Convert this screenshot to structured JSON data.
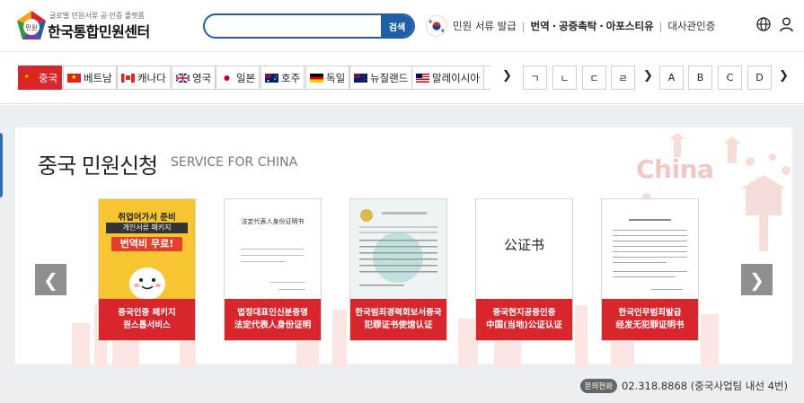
{
  "header": {
    "tagline": "글로벌 민원서류 공·인증 플랫폼",
    "site_name": "한국통합민원센터",
    "logo_badge": "민원",
    "search": {
      "value": "",
      "placeholder": "",
      "button_label": "검색"
    },
    "nav": {
      "issue": "민원 서류 발급",
      "translate": "번역",
      "notary": "공증촉탁",
      "apostille": "아포스티유",
      "embassy": "대사관인증",
      "dot": "·"
    },
    "icons": [
      "globe-icon",
      "user-icon",
      "korea-flag-icon"
    ]
  },
  "countries": [
    {
      "label": "중국",
      "active": true
    },
    {
      "label": "베트남",
      "active": false
    },
    {
      "label": "캐나다",
      "active": false
    },
    {
      "label": "영국",
      "active": false
    },
    {
      "label": "일본",
      "active": false
    },
    {
      "label": "호주",
      "active": false
    },
    {
      "label": "독일",
      "active": false
    },
    {
      "label": "뉴질랜드",
      "active": false
    },
    {
      "label": "말레이시아",
      "active": false
    }
  ],
  "consonants": [
    "ㄱ",
    "ㄴ",
    "ㄷ",
    "ㄹ"
  ],
  "letters": [
    "A",
    "B",
    "C",
    "D"
  ],
  "arrow": "❯",
  "section": {
    "title_ko": "중국 민원신청",
    "title_en": "SERVICE FOR CHINA",
    "bg_word": "China",
    "prev": "❮",
    "next": "❯"
  },
  "cards": [
    {
      "line1": "중국인증 패키지",
      "line2": "원스톱서비스",
      "image_text": {
        "l1": "취업어가서 준비",
        "l2": "개인서류 패키지",
        "l3": "번역비 무료!"
      }
    },
    {
      "line1": "법정대표인신분증명",
      "line2": "法定代表人身份证明",
      "image_text": {
        "l1": "法定代表人身份证明书"
      }
    },
    {
      "line1": "한국범죄경력회보서중국",
      "line2": "犯罪证书使馆认证",
      "image_text": {}
    },
    {
      "line1": "중국현지공증인증",
      "line2": "中国(当地)公证认证",
      "image_text": {
        "l1": "公证书"
      }
    },
    {
      "line1": "한국인무범죄발급",
      "line2": "经发无犯罪证明书",
      "image_text": {}
    }
  ],
  "footer": {
    "badge": "문의전화",
    "phone": "02.318.8868 (중국사업팀 내선 4번)"
  },
  "colors": {
    "accent_red": "#d8262c",
    "brand_blue": "#1f5fa8",
    "bg_gray": "#eceff2"
  }
}
